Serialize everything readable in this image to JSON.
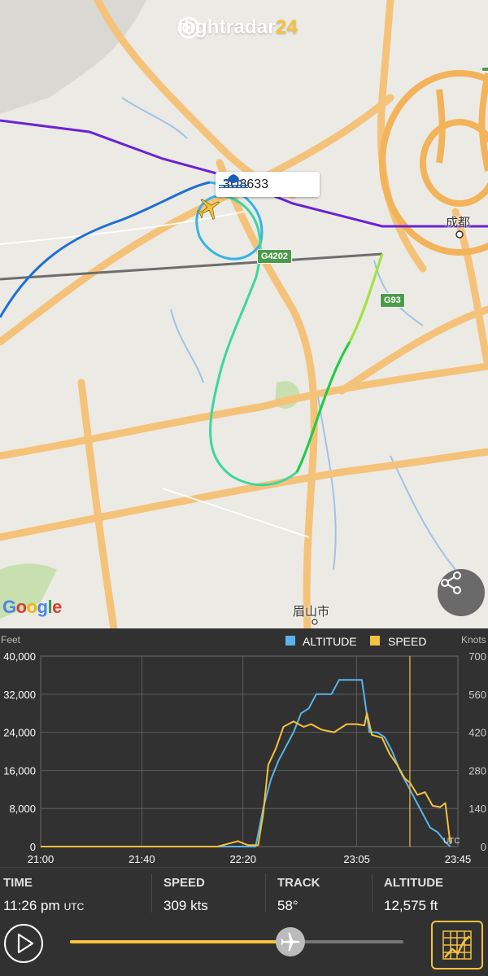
{
  "app": {
    "brand_main": "flightradar",
    "brand_num": "24"
  },
  "map": {
    "callsign": "3U8633",
    "city_label": "成都",
    "town_label": "眉山市",
    "attribution": "Google",
    "road_shields": [
      "G4202",
      "G93"
    ]
  },
  "chart": {
    "left_unit": "Feet",
    "right_unit": "Knots",
    "legend": [
      {
        "label": "ALTITUDE",
        "color": "#5ab4ea"
      },
      {
        "label": "SPEED",
        "color": "#f6c23e"
      }
    ],
    "utc_label": "UTC"
  },
  "chart_data": {
    "type": "line",
    "x_ticks": [
      "21:00",
      "21:40",
      "22:20",
      "23:05",
      "23:45"
    ],
    "x_minutes": [
      0,
      40,
      80,
      125,
      165
    ],
    "y_left_ticks": [
      "0",
      "8,000",
      "16,000",
      "24,000",
      "32,000",
      "40,000"
    ],
    "y_right_ticks": [
      "0",
      "140",
      "280",
      "420",
      "560",
      "700"
    ],
    "ylim_left": [
      0,
      40000
    ],
    "ylim_right": [
      0,
      700
    ],
    "current_time_minute": 146,
    "series": [
      {
        "name": "ALTITUDE",
        "axis": "left",
        "color": "#5ab4ea",
        "x": [
          0,
          85,
          88,
          91,
          94,
          97,
          100,
          103,
          106,
          109,
          112,
          115,
          118,
          121,
          124,
          127,
          130,
          133,
          136,
          139,
          142,
          145,
          148,
          151,
          154,
          157,
          160,
          162
        ],
        "y": [
          0,
          0,
          8000,
          14000,
          18000,
          21000,
          24000,
          28000,
          29000,
          32000,
          32000,
          32000,
          35000,
          35000,
          35000,
          35000,
          24000,
          24000,
          23000,
          20000,
          16000,
          13000,
          10000,
          7000,
          4000,
          3000,
          1000,
          0
        ]
      },
      {
        "name": "SPEED",
        "axis": "right",
        "color": "#f6c23e",
        "x": [
          0,
          70,
          78,
          82,
          86,
          88,
          90,
          93,
          96,
          100,
          104,
          107,
          111,
          116,
          121,
          125,
          128,
          129,
          131,
          135,
          138,
          141,
          144,
          146,
          149,
          152,
          155,
          158,
          160,
          162
        ],
        "y": [
          0,
          0,
          20,
          5,
          5,
          120,
          300,
          360,
          440,
          460,
          440,
          450,
          430,
          420,
          450,
          450,
          445,
          490,
          410,
          400,
          340,
          300,
          250,
          235,
          190,
          200,
          150,
          145,
          160,
          10
        ]
      }
    ]
  },
  "stats": [
    {
      "label": "TIME",
      "value": "11:26 pm",
      "unit": "UTC"
    },
    {
      "label": "SPEED",
      "value": "309 kts"
    },
    {
      "label": "TRACK",
      "value": "58°"
    },
    {
      "label": "ALTITUDE",
      "value": "12,575 ft"
    }
  ],
  "playback": {
    "progress": 0.66
  }
}
